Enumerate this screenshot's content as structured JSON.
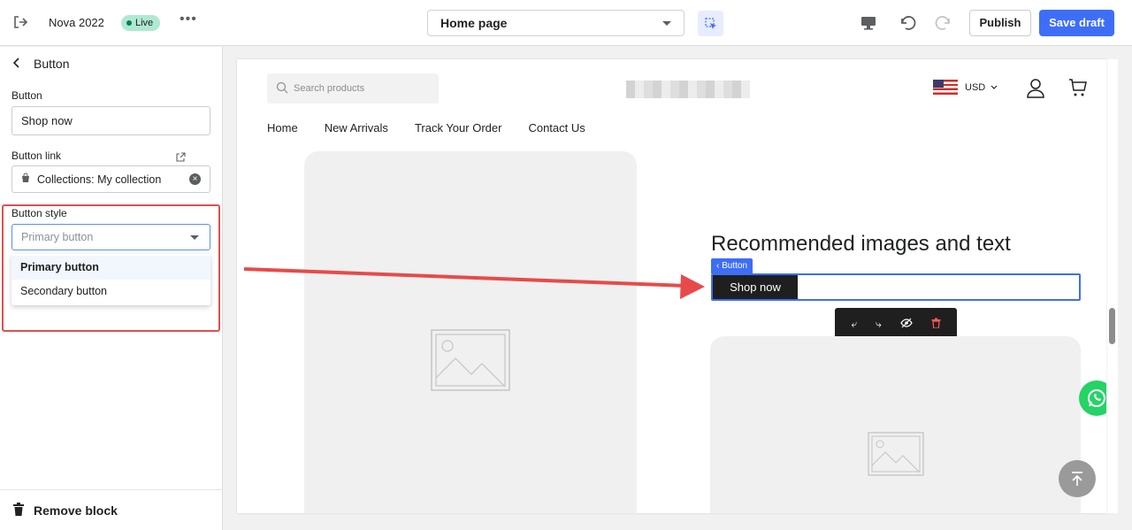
{
  "topbar": {
    "store_name": "Nova 2022",
    "status": "Live",
    "page_selector": "Home page",
    "publish_label": "Publish",
    "save_label": "Save draft"
  },
  "sidebar": {
    "title": "Button",
    "button_label": "Button",
    "button_value": "Shop now",
    "link_label": "Button link",
    "link_value": "Collections: My collection",
    "style_label": "Button style",
    "style_placeholder": "Primary button",
    "style_options": [
      "Primary button",
      "Secondary button"
    ],
    "remove_label": "Remove block"
  },
  "preview": {
    "search_placeholder": "Search products",
    "currency": "USD",
    "nav": [
      "Home",
      "New Arrivals",
      "Track Your Order",
      "Contact Us"
    ],
    "section_title": "Recommended images and text",
    "selection_tag": "Button",
    "button_text": "Shop now"
  },
  "colors": {
    "accent": "#3e6ef7",
    "annotation": "#e04f4f",
    "live_badge": "#aee9d1"
  }
}
